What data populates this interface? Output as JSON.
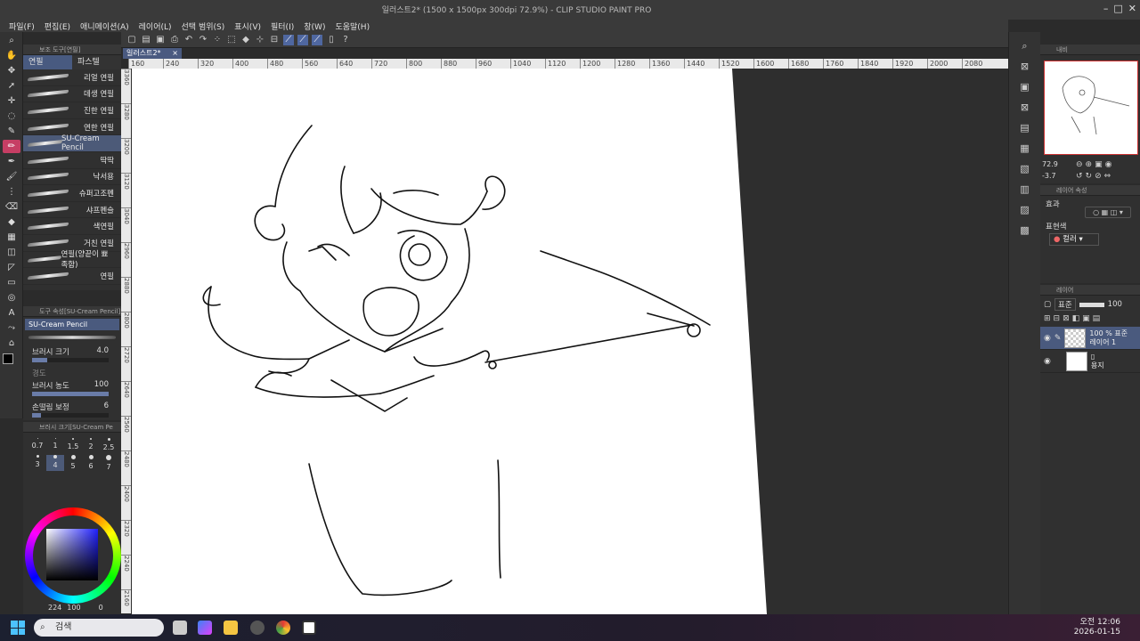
{
  "window": {
    "title": "일러스트2* (1500 x 1500px 300dpi 72.9%) - CLIP STUDIO PAINT PRO"
  },
  "menu": [
    "파일(F)",
    "편집(E)",
    "애니메이션(A)",
    "레이어(L)",
    "선택 범위(S)",
    "표시(V)",
    "필터(I)",
    "창(W)",
    "도움말(H)"
  ],
  "document_tab": "일러스트2*",
  "subtool_panel": {
    "header": "보조 도구[연필]",
    "tabs": [
      "연필",
      "파스텔"
    ],
    "brushes": [
      "리얼 연필",
      "데생 연필",
      "진한 연필",
      "연한 연필",
      "SU-Cream Pencil",
      "딱딱",
      "낙서용",
      "슈퍼고조펜",
      "샤프펜슬",
      "색연필",
      "거친 연필",
      "연필(양끝이 뾰족함)",
      "연필"
    ],
    "selected_index": 4
  },
  "tool_property": {
    "header": "도구 속성[SU-Cream Pencil]",
    "brush_name": "SU-Cream Pencil",
    "brush_size_label": "브러시 크기",
    "brush_size_value": "4.0",
    "hardness_label": "경도",
    "density_label": "브러시 농도",
    "density_value": "100",
    "density_fraction": 1.0,
    "stabilization_label": "손떨림 보정",
    "stabilization_value": "6"
  },
  "brush_size_panel": {
    "header": "브러시 크기[SU-Cream Pe",
    "sizes": [
      "0.7",
      "1",
      "1.5",
      "2",
      "2.5",
      "3",
      "4",
      "5",
      "6",
      "7"
    ],
    "selected": "4"
  },
  "color": {
    "readout": "224",
    "readout2": "100",
    "readout3": "0",
    "main": "#000000",
    "sub": "#ffffff"
  },
  "ruler_h": [
    "160",
    "240",
    "320",
    "400",
    "480",
    "560",
    "640",
    "720",
    "800",
    "880",
    "960",
    "1040",
    "1120",
    "1200",
    "1280",
    "1360",
    "1440",
    "1520",
    "1600",
    "1680",
    "1760",
    "1840",
    "1920",
    "2000",
    "2080"
  ],
  "ruler_v": [
    "3360",
    "3280",
    "3200",
    "3120",
    "3040",
    "2960",
    "2880",
    "2800",
    "2720",
    "2640",
    "2560",
    "2480",
    "2400",
    "2320",
    "2240",
    "2160"
  ],
  "navigator": {
    "header": "내비",
    "zoom": "72.9",
    "rotate": "-3.7"
  },
  "layer_property": {
    "header": "레이어 속성",
    "effect_label": "효과",
    "expression_label": "표현색",
    "expression_value": "컬러"
  },
  "layers": {
    "header": "레이어",
    "blend": "표준",
    "opacity": "100",
    "items": [
      {
        "line1": "100 % 표준",
        "line2": "레이어 1"
      },
      {
        "line1": "",
        "line2": "용지"
      }
    ]
  },
  "taskbar": {
    "search_placeholder": "검색",
    "time": "오전 12:06",
    "date": "2026-01-15"
  }
}
